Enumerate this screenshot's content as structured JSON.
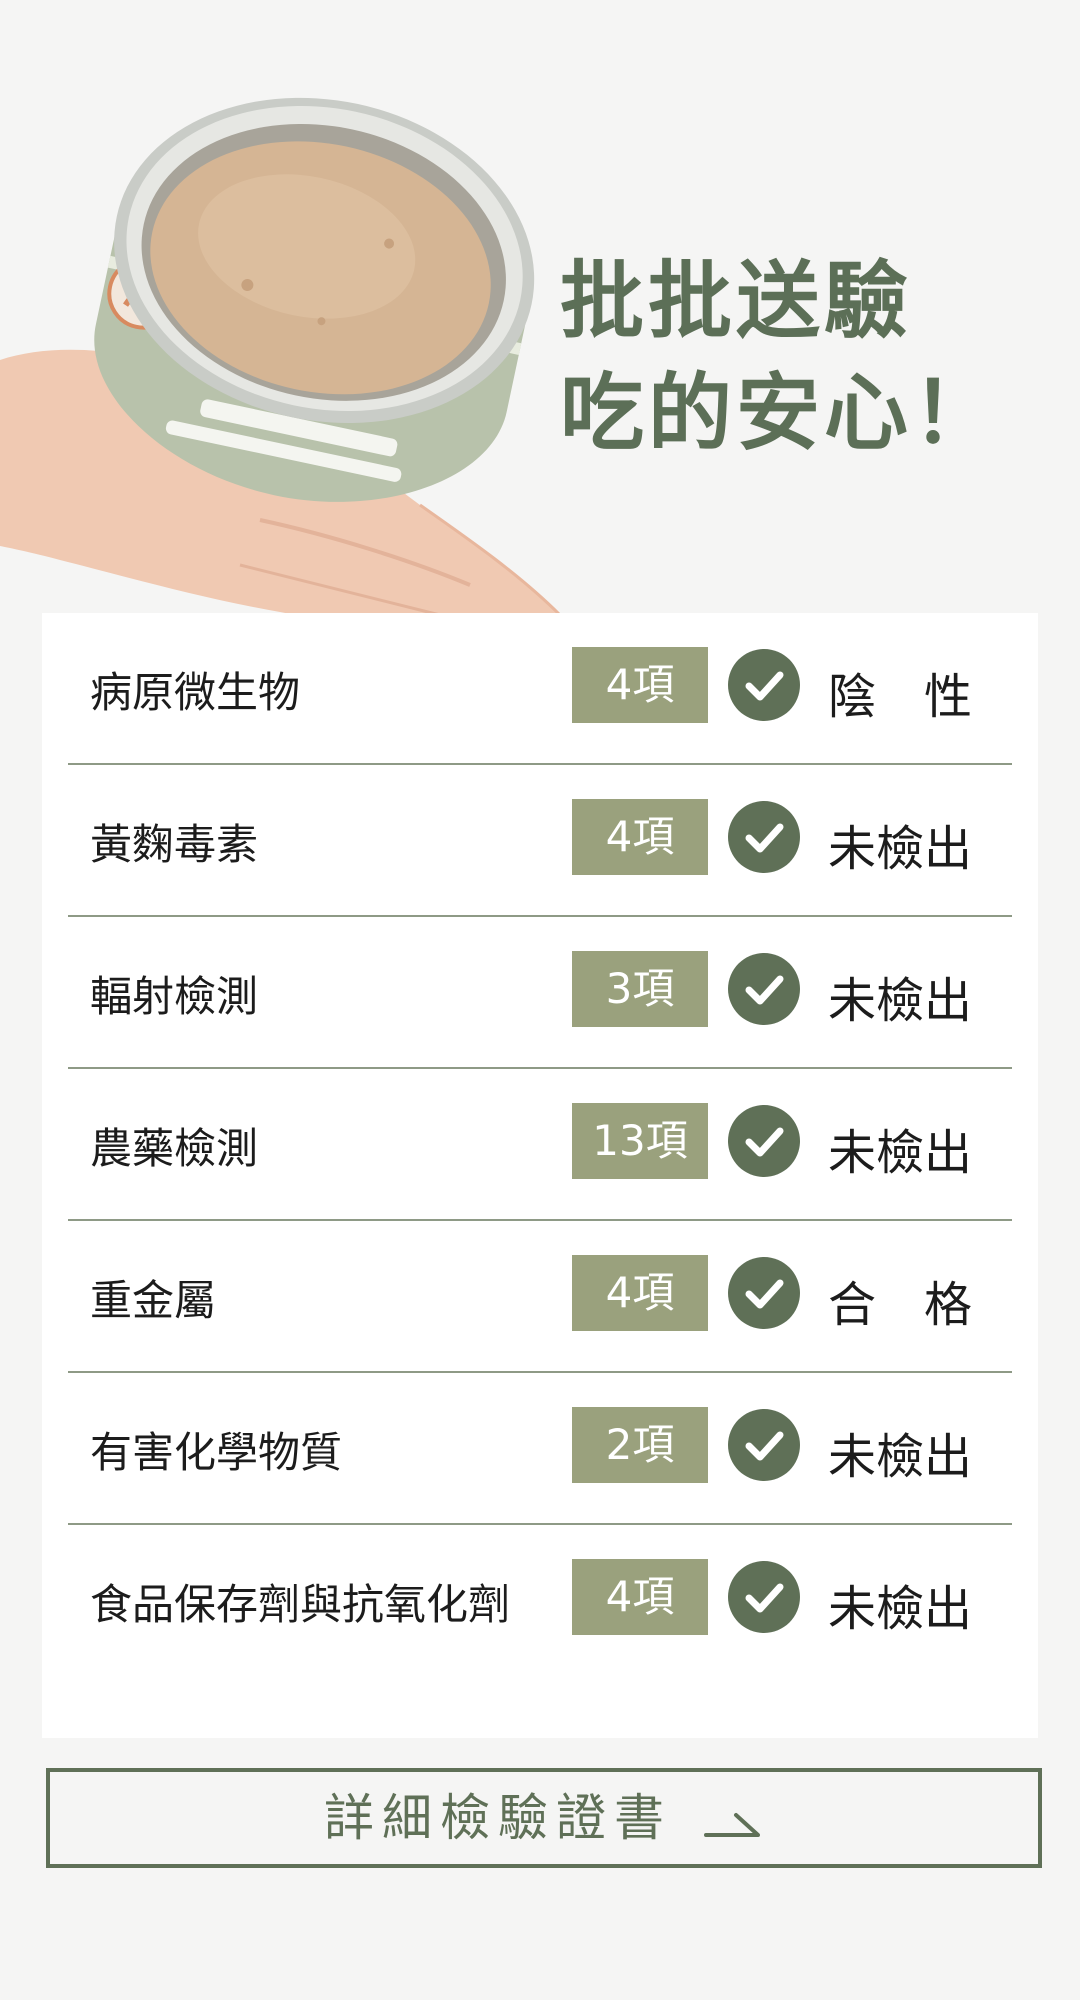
{
  "headline": {
    "line1": "批批送驗",
    "line2": "吃的安心！"
  },
  "tests": [
    {
      "name": "病原微生物",
      "count": "4項",
      "result": "陰　性"
    },
    {
      "name": "黃麴毒素",
      "count": "4項",
      "result": "未檢出"
    },
    {
      "name": "輻射檢測",
      "count": "3項",
      "result": "未檢出"
    },
    {
      "name": "農藥檢測",
      "count": "13項",
      "result": "未檢出"
    },
    {
      "name": "重金屬",
      "count": "4項",
      "result": "合　格"
    },
    {
      "name": "有害化學物質",
      "count": "2項",
      "result": "未檢出"
    },
    {
      "name": "食品保存劑與抗氧化劑",
      "count": "4項",
      "result": "未檢出"
    }
  ],
  "check_icon": "check-circle-icon",
  "button": {
    "label": "詳細檢驗證書",
    "icon": "arrow-right-icon"
  },
  "colors": {
    "brand_green": "#5f7057",
    "badge_olive": "#9aa17d",
    "background": "#f5f5f4"
  }
}
